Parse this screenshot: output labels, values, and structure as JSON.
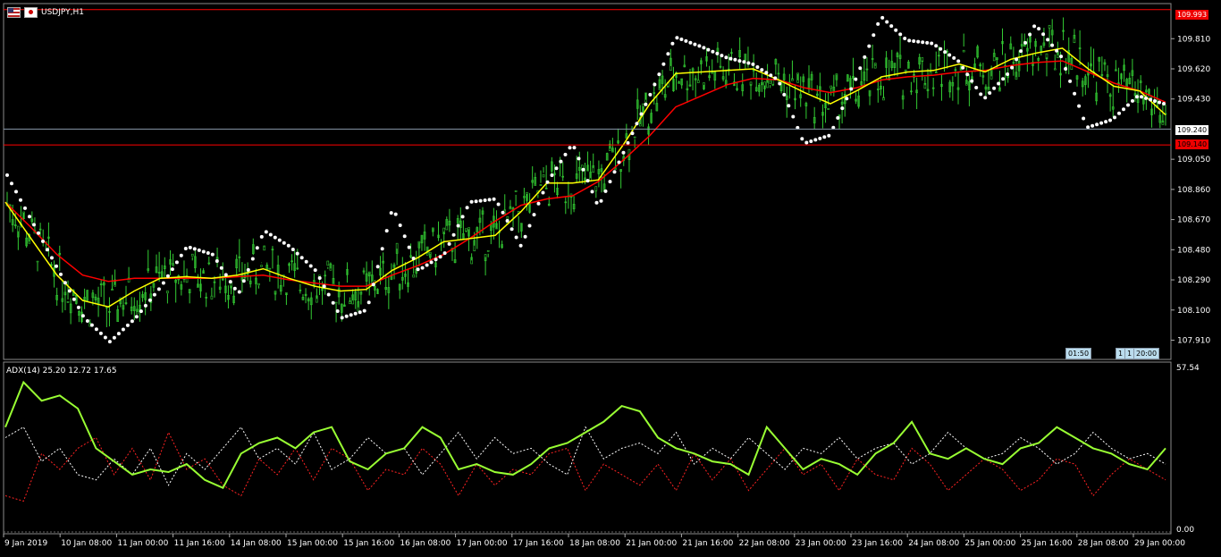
{
  "window": {
    "symbol_title": "USDJPY,H1"
  },
  "price_axis": {
    "labels": [
      "109.810",
      "109.620",
      "109.430",
      "109.050",
      "108.860",
      "108.670",
      "108.480",
      "108.290",
      "108.100",
      "107.910"
    ],
    "high_tag": "109.993",
    "current_tag": "109.240",
    "low_tag": "109.140"
  },
  "indicator": {
    "label": "ADX(14) 25.20 12.72 17.65",
    "axis_top": "57.54",
    "axis_bottom": "0.00"
  },
  "time_axis": [
    "9 Jan 2019",
    "10 Jan 08:00",
    "11 Jan 00:00",
    "11 Jan 16:00",
    "14 Jan 08:00",
    "15 Jan 00:00",
    "15 Jan 16:00",
    "16 Jan 08:00",
    "17 Jan 00:00",
    "17 Jan 16:00",
    "18 Jan 08:00",
    "21 Jan 00:00",
    "21 Jan 16:00",
    "22 Jan 08:00",
    "23 Jan 00:00",
    "23 Jan 16:00",
    "24 Jan 08:00",
    "25 Jan 00:00",
    "25 Jan 16:00",
    "28 Jan 08:00",
    "29 Jan 00:00"
  ],
  "period_labels": {
    "p1": "01:50",
    "p2": "1",
    "p3": "1",
    "p4": "20:00"
  },
  "colors": {
    "candles": "#33cc33",
    "ma_fast": "#ffff00",
    "ma_slow": "#ff0000",
    "sar": "#ffffff",
    "adx": "#99ff33",
    "di_plus": "#ffffff",
    "di_minus": "#ff2222",
    "grid_line": "#ff0000",
    "bid_line": "#8899aa"
  },
  "chart_data": [
    {
      "type": "line",
      "title": "USDJPY,H1",
      "ylim": [
        107.8,
        110.02
      ],
      "series": [
        {
          "name": "MA fast",
          "values": [
            108.78,
            108.55,
            108.32,
            108.16,
            108.12,
            108.22,
            108.3,
            108.31,
            108.3,
            108.32,
            108.36,
            108.3,
            108.25,
            108.22,
            108.23,
            108.35,
            108.43,
            108.53,
            108.55,
            108.57,
            108.72,
            108.9,
            108.9,
            108.92,
            109.15,
            109.4,
            109.59,
            109.6,
            109.61,
            109.62,
            109.55,
            109.47,
            109.4,
            109.48,
            109.57,
            109.6,
            109.61,
            109.65,
            109.6,
            109.68,
            109.72,
            109.75,
            109.62,
            109.51,
            109.48,
            109.33
          ]
        },
        {
          "name": "MA slow",
          "values": [
            108.78,
            108.62,
            108.45,
            108.32,
            108.28,
            108.3,
            108.3,
            108.3,
            108.3,
            108.31,
            108.32,
            108.29,
            108.27,
            108.25,
            108.25,
            108.32,
            108.38,
            108.45,
            108.55,
            108.66,
            108.76,
            108.8,
            108.82,
            108.91,
            109.05,
            109.2,
            109.38,
            109.45,
            109.52,
            109.56,
            109.55,
            109.5,
            109.47,
            109.5,
            109.55,
            109.57,
            109.58,
            109.6,
            109.61,
            109.64,
            109.66,
            109.67,
            109.6,
            109.53,
            109.48,
            109.41
          ]
        },
        {
          "name": "SAR",
          "values": [
            108.95,
            108.65,
            108.35,
            108.05,
            107.9,
            108.05,
            108.25,
            108.5,
            108.45,
            108.2,
            108.6,
            108.5,
            108.35,
            108.05,
            108.1,
            108.75,
            108.35,
            108.45,
            108.78,
            108.8,
            108.5,
            108.9,
            109.15,
            108.75,
            109.1,
            109.45,
            109.82,
            109.76,
            109.69,
            109.65,
            109.55,
            109.15,
            109.2,
            109.55,
            109.95,
            109.8,
            109.78,
            109.67,
            109.43,
            109.6,
            109.9,
            109.7,
            109.25,
            109.3,
            109.45,
            109.4
          ]
        }
      ]
    },
    {
      "type": "line",
      "title": "ADX(14) 25.20 12.72 17.65",
      "ylim": [
        0,
        57.54
      ],
      "series": [
        {
          "name": "ADX",
          "values": [
            38,
            55,
            48,
            50,
            45,
            30,
            25,
            20,
            22,
            21,
            24,
            18,
            15,
            28,
            32,
            34,
            30,
            36,
            38,
            25,
            22,
            28,
            30,
            38,
            34,
            22,
            24,
            21,
            20,
            24,
            30,
            32,
            36,
            40,
            46,
            44,
            34,
            30,
            28,
            25,
            24,
            20,
            38,
            30,
            22,
            26,
            24,
            20,
            28,
            32,
            40,
            28,
            26,
            30,
            26,
            24,
            30,
            32,
            38,
            34,
            30,
            28,
            24,
            22,
            30
          ]
        },
        {
          "name": "DI",
          "values": [
            34,
            38,
            25,
            30,
            20,
            18,
            26,
            20,
            30,
            16,
            28,
            22,
            30,
            38,
            26,
            30,
            24,
            36,
            22,
            26,
            34,
            28,
            30,
            20,
            28,
            36,
            26,
            34,
            28,
            30,
            24,
            20,
            38,
            26,
            30,
            32,
            28,
            36,
            24,
            30,
            26,
            34,
            28,
            22,
            30,
            28,
            34,
            26,
            30,
            32,
            24,
            28,
            36,
            30,
            26,
            28,
            34,
            30,
            24,
            28,
            36,
            30,
            26,
            28,
            24
          ]
        },
        {
          "name": "DI",
          "values": [
            12,
            10,
            28,
            22,
            30,
            34,
            20,
            30,
            18,
            36,
            22,
            26,
            16,
            12,
            26,
            20,
            30,
            18,
            30,
            26,
            14,
            22,
            20,
            30,
            24,
            12,
            24,
            16,
            22,
            20,
            28,
            30,
            14,
            24,
            20,
            16,
            24,
            14,
            28,
            18,
            26,
            14,
            22,
            30,
            20,
            24,
            14,
            26,
            20,
            18,
            30,
            24,
            14,
            20,
            26,
            22,
            14,
            18,
            26,
            24,
            12,
            20,
            26,
            22,
            18
          ]
        }
      ]
    }
  ]
}
